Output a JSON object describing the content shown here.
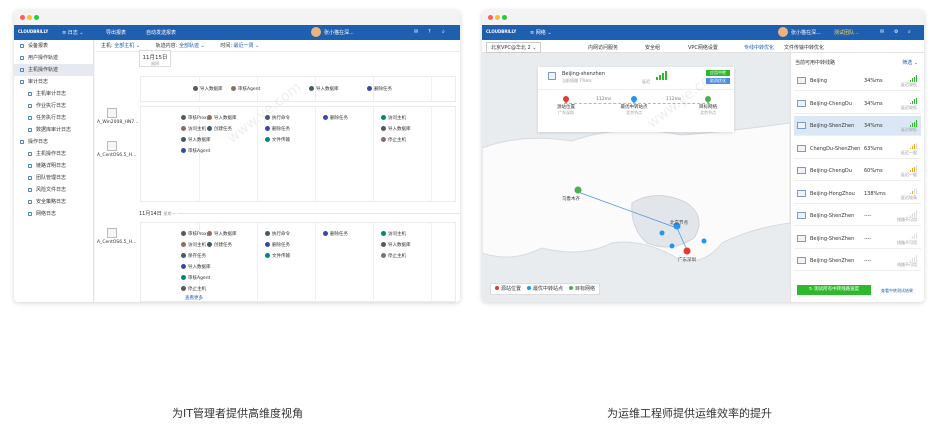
{
  "left": {
    "app": {
      "logo": "CLOUDBRILLY",
      "menu_label": "≡ 日志 ⌄",
      "tool1": "导出报表",
      "tool2": "自动发送报表",
      "user": "张小猫在深..."
    },
    "sidebar": [
      {
        "label": "设备报表",
        "sub": false,
        "active": false
      },
      {
        "label": "用户操作轨迹",
        "sub": false,
        "active": false
      },
      {
        "label": "主机操作轨迹",
        "sub": false,
        "active": true
      },
      {
        "label": "审计日志",
        "sub": false,
        "active": false
      },
      {
        "label": "主机审计日志",
        "sub": true,
        "active": false
      },
      {
        "label": "作业执行日志",
        "sub": true,
        "active": false
      },
      {
        "label": "任务执行日志",
        "sub": true,
        "active": false
      },
      {
        "label": "数据库审计日志",
        "sub": true,
        "active": false
      },
      {
        "label": "操作日志",
        "sub": false,
        "active": false
      },
      {
        "label": "主机操作日志",
        "sub": true,
        "active": false
      },
      {
        "label": "链路详明日志",
        "sub": true,
        "active": false
      },
      {
        "label": "团队管理日志",
        "sub": true,
        "active": false
      },
      {
        "label": "风险文件日志",
        "sub": true,
        "active": false
      },
      {
        "label": "安全策略日志",
        "sub": true,
        "active": false
      },
      {
        "label": "网络日志",
        "sub": true,
        "active": false
      }
    ],
    "filter": {
      "host_label": "主机:",
      "host_value": "全部主机 ⌄",
      "track_label": "轨迹内容:",
      "track_value": "全部轨迹 ⌄",
      "time_label": "时间:",
      "time_value": "最近一周 ⌄"
    },
    "day1": {
      "date": "11月15日",
      "weekday": "周四"
    },
    "day2": {
      "date": "11月14日",
      "weekday": "星期一"
    },
    "hosts": [
      "A_Win2008_HN7...",
      "A_CentOS6.5_H...",
      "A_CentOS6.5_H..."
    ],
    "group1": [
      {
        "text": "导入数据库",
        "col": 1
      },
      {
        "text": "审核Agent",
        "col": 2
      },
      {
        "text": "导入数据库",
        "col": 3
      },
      {
        "text": "删除任务",
        "col": 4
      }
    ],
    "group2": [
      [
        "审核Proxy",
        "访问主机",
        "导入数据库",
        "审核Agent"
      ],
      [
        "导入数据库",
        "创建任务"
      ],
      [
        "执行命令",
        "删除任务",
        "文件传输"
      ],
      [
        "删除任务"
      ],
      [
        "访问主机",
        "导入数据库",
        "停止主机"
      ]
    ],
    "group3": [
      [
        "审核Proxy",
        "访问主机",
        "保存任务",
        "导入数据库",
        "审核Agent",
        "停止主机"
      ],
      [
        "导入数据库",
        "创建任务"
      ],
      [
        "执行命令",
        "删除任务",
        "文件传输"
      ],
      [
        "删除任务"
      ],
      [
        "访问主机",
        "导入数据库",
        "停止主机"
      ]
    ],
    "more": "查看更多",
    "caption": "为IT管理者提供高维度视角"
  },
  "right": {
    "app": {
      "logo": "CLOUDBRILLY",
      "menu_label": "≡ 网络 ⌄",
      "user": "张小猫在深...",
      "team": "测试团队..."
    },
    "vpc": "北京VPC@华北 2 ⌄",
    "tabs": [
      "内网访问服务",
      "安全组",
      "VPC网络设置",
      "专线中转优化",
      "文件传输中转优化"
    ],
    "active_tab": 3,
    "route_card": {
      "title": "Beijing-shenzhen",
      "sub": "当前线路  7%ms",
      "latency": "延迟",
      "btn1": "应用中转",
      "btn2": "取消优化"
    },
    "route_nodes": [
      {
        "name": "源站位置",
        "sub": "广东深圳",
        "color": "#e53935"
      },
      {
        "name": "最优中转站点",
        "sub": "北京节点",
        "color": "#2196f3"
      },
      {
        "name": "目标网络",
        "sub": "北京节点",
        "color": "#4caf50"
      }
    ],
    "route_ms": [
      "112ms",
      "112ms"
    ],
    "map_labels": {
      "origin": "乌鲁木齐",
      "mid": "北京节点",
      "dest": "广东深圳"
    },
    "legend": [
      "源站位置",
      "最优中转站点",
      "目标网络"
    ],
    "panel_title": "当前可用中转线路",
    "filter": "筛选 ⌄",
    "routes": [
      {
        "name": "Beijing",
        "ms": "34%ms",
        "level": 4,
        "status": "延迟较低"
      },
      {
        "name": "Beijing-ChengDu",
        "ms": "34%ms",
        "level": 4,
        "status": "延迟较低"
      },
      {
        "name": "Beijing-ShenZhen",
        "ms": "34%ms",
        "level": 4,
        "status": "延迟较低"
      },
      {
        "name": "ChengDu-ShenZhen",
        "ms": "63%ms",
        "level": 3,
        "status": "延迟一般"
      },
      {
        "name": "Beijing-ChengDu",
        "ms": "60%ms",
        "level": 3,
        "status": "延迟一般"
      },
      {
        "name": "Beijing-HongZhou",
        "ms": "138%ms",
        "level": 2,
        "status": "延迟较高"
      },
      {
        "name": "Beijing-ShenZhen",
        "ms": "----",
        "level": 0,
        "status": "线路不可用"
      },
      {
        "name": "Beijing-ShenZhen",
        "ms": "----",
        "level": 0,
        "status": "线路不可用"
      },
      {
        "name": "Beijing-ShenZhen",
        "ms": "----",
        "level": 0,
        "status": "线路不可用"
      }
    ],
    "selected_route": 2,
    "test_btn": "测试所有中转线路速度",
    "test_link": "查看中转测试结果",
    "caption": "为运维工程师提供运维效率的提升"
  },
  "colors": {
    "brand": "#1e5fb0",
    "green": "#2eb82e",
    "red": "#e53935",
    "blue": "#2196f3"
  }
}
